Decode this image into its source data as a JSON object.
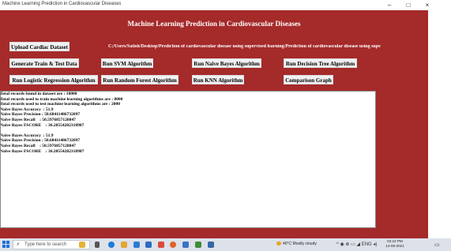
{
  "window": {
    "title": "Machine Learning Prediction in Cardiovascular Diseases",
    "controls": {
      "minimize": "–",
      "maximize": "□",
      "close": "×"
    }
  },
  "app": {
    "heading": "Machine Learning Prediction in Cardiovascular Diseases",
    "path": "C:/Users/Satish/Desktop/Prediction of cardiovascular disease using supervised learning/Prediction of cardiovascular disease using supe"
  },
  "buttons": {
    "upload": "Upload Cardiac Dataset",
    "generate": "Generate Train & Test Data",
    "svm": "Run SVM Algorithm",
    "naive_bayes": "Run Naive Bayes Algorithm",
    "decision_tree": "Run Decision Tree Algorithm",
    "logistic": "Run Logistic Regression Algorithm",
    "random_forest": "Run Random Forest Algorithm",
    "knn": "Run KNN Algorithm",
    "comparison": "Comparison Graph"
  },
  "output_lines": [
    "Total records found in dataset are : 10000",
    "Total records used to train machine learning algorithms are : 8000",
    "Total records used to test machine learning algorithms are : 2000",
    "Naive Bayes Accuracy  : 51.9",
    "Naive Bayes Precision : 58.68411486732097",
    "Naive Bayes Recall    : 50.5976857128847",
    "Naive Bayes FSCORE    : 36.20554282318987",
    "",
    "Naive Bayes Accuracy  : 51.9",
    "Naive Bayes Precision : 58.68411486732097",
    "Naive Bayes Recall    : 50.5976857128847",
    "Naive Bayes FSCORE    : 36.20554282318987"
  ],
  "taskbar": {
    "search_placeholder": "Type here to search",
    "weather": "40°C  Mostly cloudy",
    "time": "02:22 PM",
    "date": "14-06-2021",
    "tray": "^ ◉ ⊕ ▭ ◢ ENG ◂)",
    "colors": {
      "start": "#1e6fd9",
      "accent": "#a52a2a"
    }
  }
}
